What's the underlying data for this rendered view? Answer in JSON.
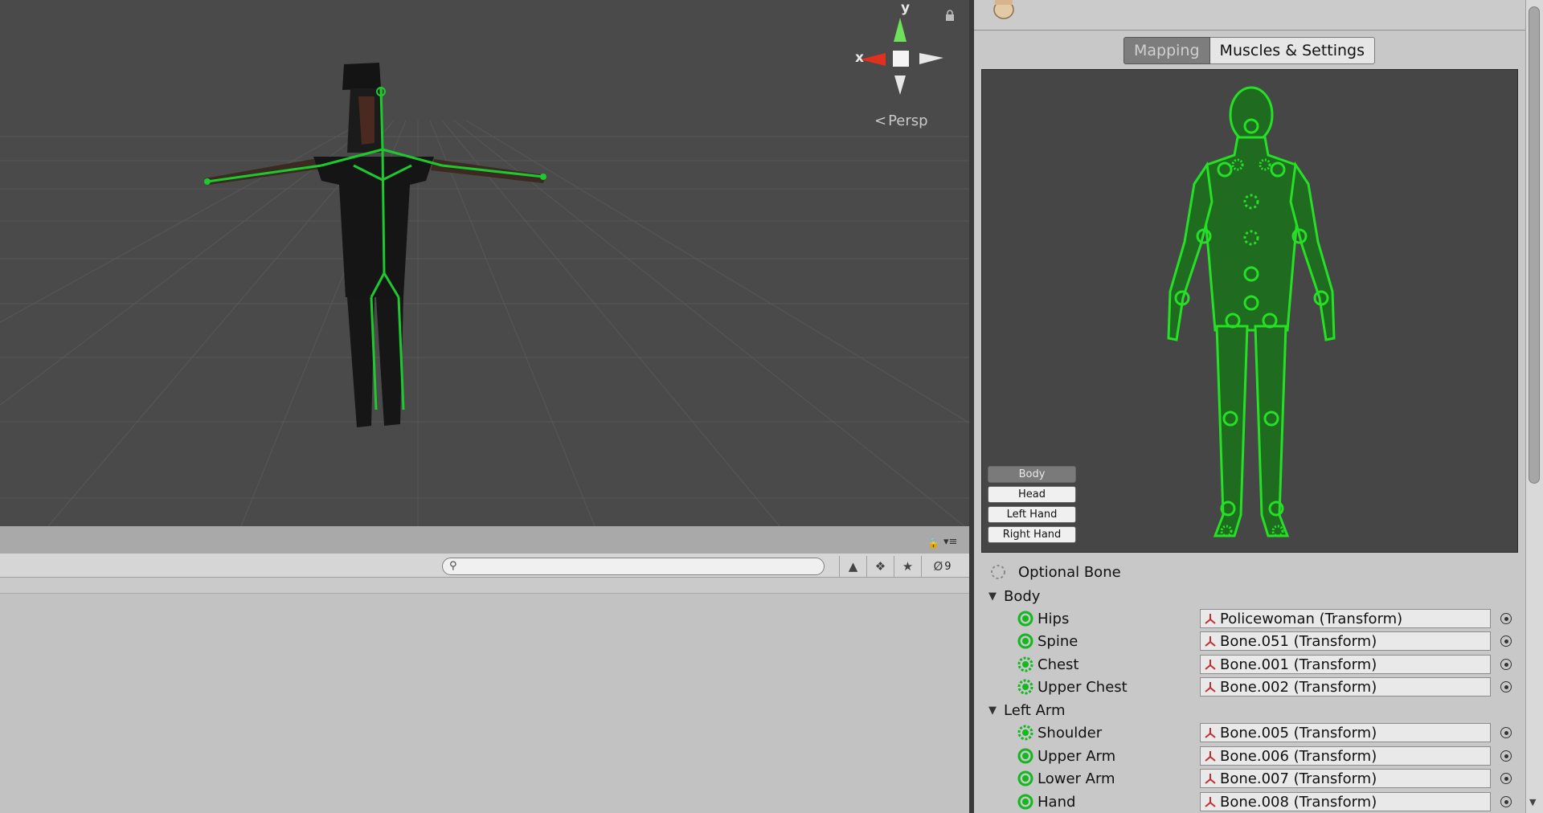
{
  "scene": {
    "axis_x": "x",
    "axis_y": "y",
    "projection": "Persp",
    "projection_icon": "perspective-icon"
  },
  "hierarchy": {
    "search_placeholder": "",
    "hidden_count": "9",
    "icons": [
      "lock-icon",
      "menu-icon",
      "search-icon",
      "scene-visibility-icon",
      "label-icon",
      "star-icon",
      "eye-hidden-icon"
    ]
  },
  "inspector": {
    "tabs": [
      {
        "label": "Mapping",
        "active": true
      },
      {
        "label": "Muscles & Settings",
        "active": false
      }
    ],
    "body_parts": [
      "Body",
      "Head",
      "Left Hand",
      "Right Hand"
    ],
    "optional_bone_label": "Optional Bone",
    "sections": [
      {
        "label": "Body",
        "bones": [
          {
            "name": "Hips",
            "value": "Policewoman (Transform)",
            "optional": false
          },
          {
            "name": "Spine",
            "value": "Bone.051 (Transform)",
            "optional": false
          },
          {
            "name": "Chest",
            "value": "Bone.001 (Transform)",
            "optional": true
          },
          {
            "name": "Upper Chest",
            "value": "Bone.002 (Transform)",
            "optional": true
          }
        ]
      },
      {
        "label": "Left Arm",
        "bones": [
          {
            "name": "Shoulder",
            "value": "Bone.005 (Transform)",
            "optional": true
          },
          {
            "name": "Upper Arm",
            "value": "Bone.006 (Transform)",
            "optional": false
          },
          {
            "name": "Lower Arm",
            "value": "Bone.007 (Transform)",
            "optional": false
          },
          {
            "name": "Hand",
            "value": "Bone.008 (Transform)",
            "optional": false
          }
        ]
      }
    ]
  },
  "colors": {
    "scene_bg": "#4a4a4a",
    "bone_green": "#1ec92e",
    "axis_red": "#e0301e",
    "axis_green": "#6ee05a"
  }
}
